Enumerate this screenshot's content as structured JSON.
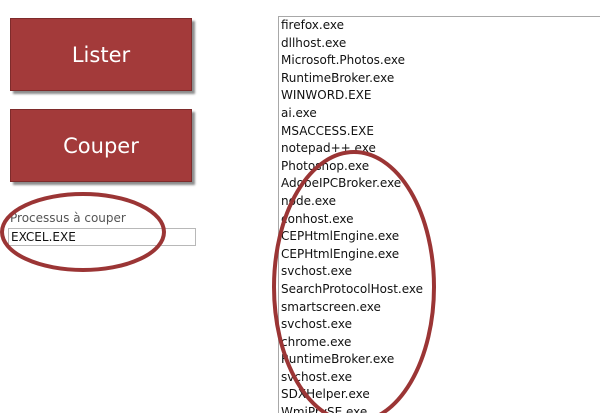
{
  "buttons": {
    "list_label": "Lister",
    "kill_label": "Couper"
  },
  "process_field": {
    "label": "Processus à couper",
    "value": "EXCEL.EXE"
  },
  "process_list": [
    "firefox.exe",
    "dllhost.exe",
    "Microsoft.Photos.exe",
    "RuntimeBroker.exe",
    "WINWORD.EXE",
    "ai.exe",
    "MSACCESS.EXE",
    "notepad++.exe",
    "Photoshop.exe",
    "AdobeIPCBroker.exe",
    "node.exe",
    "conhost.exe",
    "CEPHtmlEngine.exe",
    "CEPHtmlEngine.exe",
    "svchost.exe",
    "SearchProtocolHost.exe",
    "smartscreen.exe",
    "svchost.exe",
    "chrome.exe",
    "RuntimeBroker.exe",
    "svchost.exe",
    "SDXHelper.exe",
    "WmiPrvSE.exe"
  ],
  "colors": {
    "button_bg": "#a33a3a",
    "annotation": "#9b3535"
  }
}
